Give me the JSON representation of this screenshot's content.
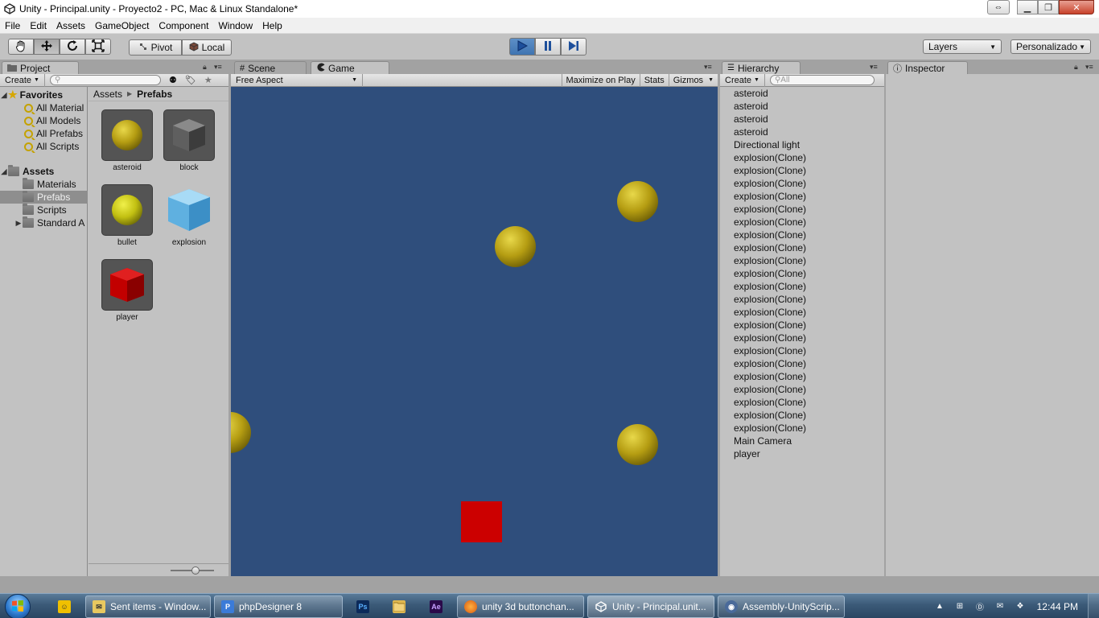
{
  "window": {
    "title": "Unity - Principal.unity - Proyecto2 - PC, Mac & Linux Standalone*"
  },
  "menu": [
    "File",
    "Edit",
    "Assets",
    "GameObject",
    "Component",
    "Window",
    "Help"
  ],
  "toolbar": {
    "tools": [
      "hand-icon",
      "move-icon",
      "rotate-icon",
      "scale-icon"
    ],
    "pivot_label": "Pivot",
    "local_label": "Local",
    "play_controls": [
      "play-icon",
      "pause-icon",
      "step-icon"
    ],
    "layers_label": "Layers",
    "layout_label": "Personalizado"
  },
  "project": {
    "tab_label": "Project",
    "create_label": "Create",
    "favorites_label": "Favorites",
    "favorites": [
      "All Material",
      "All Models",
      "All Prefabs",
      "All Scripts"
    ],
    "assets_label": "Assets",
    "folders": [
      "Materials",
      "Prefabs",
      "Scripts",
      "Standard A"
    ],
    "breadcrumb_root": "Assets",
    "breadcrumb_current": "Prefabs",
    "prefabs": [
      {
        "name": "asteroid",
        "icon": "sphere"
      },
      {
        "name": "block",
        "icon": "gray-cube"
      },
      {
        "name": "bullet",
        "icon": "sphere"
      },
      {
        "name": "explosion",
        "icon": "blue-cube"
      },
      {
        "name": "player",
        "icon": "red-cube"
      }
    ]
  },
  "scene_tab_label": "Scene",
  "game": {
    "tab_label": "Game",
    "aspect_label": "Free Aspect",
    "maximize_label": "Maximize on Play",
    "stats_label": "Stats",
    "gizmos_label": "Gizmos",
    "background_color": "#2f4e7c",
    "sphere_color": "#b59d12",
    "player_color": "#cc0000"
  },
  "hierarchy": {
    "tab_label": "Hierarchy",
    "create_label": "Create",
    "search_placeholder": "All",
    "items": [
      "asteroid",
      "asteroid",
      "asteroid",
      "asteroid",
      "Directional light",
      "explosion(Clone)",
      "explosion(Clone)",
      "explosion(Clone)",
      "explosion(Clone)",
      "explosion(Clone)",
      "explosion(Clone)",
      "explosion(Clone)",
      "explosion(Clone)",
      "explosion(Clone)",
      "explosion(Clone)",
      "explosion(Clone)",
      "explosion(Clone)",
      "explosion(Clone)",
      "explosion(Clone)",
      "explosion(Clone)",
      "explosion(Clone)",
      "explosion(Clone)",
      "explosion(Clone)",
      "explosion(Clone)",
      "explosion(Clone)",
      "explosion(Clone)",
      "explosion(Clone)",
      "Main Camera",
      "player"
    ]
  },
  "inspector": {
    "tab_label": "Inspector"
  },
  "taskbar": {
    "items": [
      {
        "label": "Sent items - Window...",
        "icon": "mail-icon"
      },
      {
        "label": "phpDesigner 8",
        "icon": "php-icon"
      },
      {
        "label": "unity 3d buttonchan...",
        "icon": "firefox-icon"
      },
      {
        "label": "Unity - Principal.unit...",
        "icon": "unity-icon"
      },
      {
        "label": "Assembly-UnityScrip...",
        "icon": "monodevelop-icon"
      }
    ],
    "pinned": [
      {
        "name": "photoshop-icon",
        "text": "Ps"
      },
      {
        "name": "explorer-icon",
        "text": ""
      },
      {
        "name": "aftereffects-icon",
        "text": "Ae"
      }
    ],
    "clock": "12:44 PM"
  }
}
